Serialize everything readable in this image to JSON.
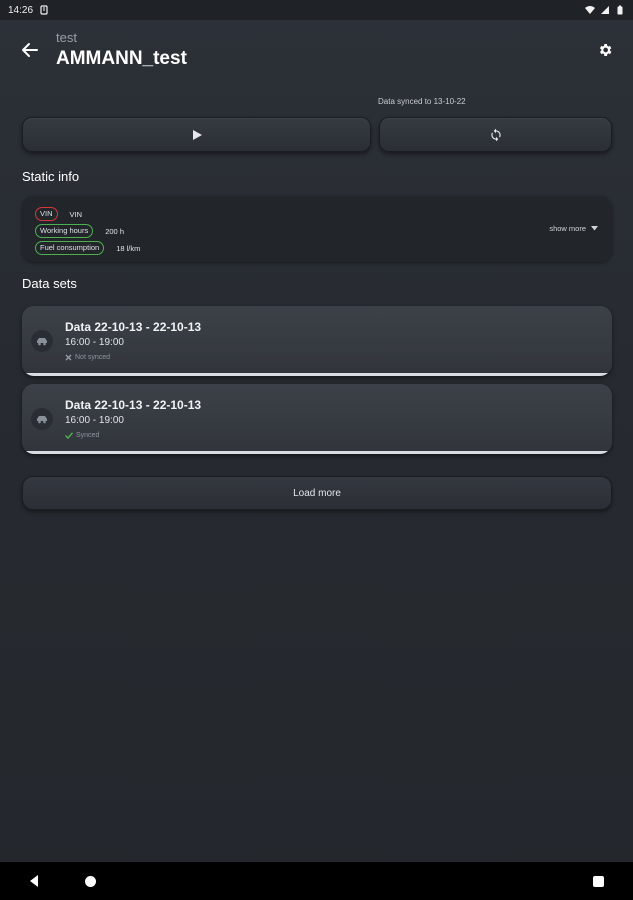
{
  "status_bar": {
    "time": "14:26"
  },
  "header": {
    "subtitle": "test",
    "title": "AMMANN_test"
  },
  "sync": {
    "text": "Data synced to 13-10-22"
  },
  "static_info": {
    "title": "Static info",
    "rows": [
      {
        "label": "VIN",
        "value": "VIN",
        "border_color": "#d23a3a"
      },
      {
        "label": "Working hours",
        "value": "200 h",
        "border_color": "#4caf50"
      },
      {
        "label": "Fuel consumption",
        "value": "18 l/km",
        "border_color": "#4caf50"
      }
    ],
    "show_more": "show more"
  },
  "data_sets": {
    "title": "Data sets",
    "items": [
      {
        "title": "Data 22-10-13 - 22-10-13",
        "time": "16:00 - 19:00",
        "status": "Not synced",
        "status_icon": "x-icon"
      },
      {
        "title": "Data 22-10-13 - 22-10-13",
        "time": "16:00 - 19:00",
        "status": "Synced",
        "status_icon": "check-icon",
        "status_color": "#4caf50"
      }
    ],
    "load_more": "Load more"
  }
}
